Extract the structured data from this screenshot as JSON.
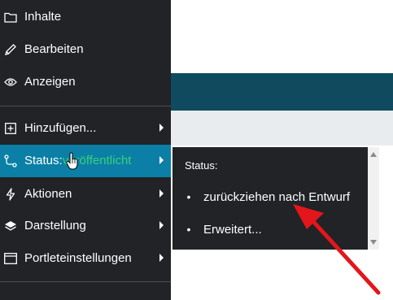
{
  "menu": {
    "items": [
      {
        "label": "Inhalte",
        "icon": "folder-icon"
      },
      {
        "label": "Bearbeiten",
        "icon": "pencil-icon"
      },
      {
        "label": "Anzeigen",
        "icon": "eye-icon"
      },
      {
        "label": "Hinzufügen...",
        "icon": "add-box-icon"
      },
      {
        "label": "Status:",
        "value": "veröffentlicht",
        "icon": "workflow-icon"
      },
      {
        "label": "Aktionen",
        "icon": "lightning-icon"
      },
      {
        "label": "Darstellung",
        "icon": "layers-icon"
      },
      {
        "label": "Portleteinstellungen",
        "icon": "window-icon"
      }
    ]
  },
  "submenu": {
    "title": "Status:",
    "items": [
      {
        "label": "zurückziehen nach Entwurf"
      },
      {
        "label": "Erweitert..."
      }
    ]
  },
  "colors": {
    "toolbar_bg": "#212327",
    "active_bg": "#0b7fa6",
    "status_value": "#39d17a",
    "annotation_arrow": "#e3161b"
  }
}
